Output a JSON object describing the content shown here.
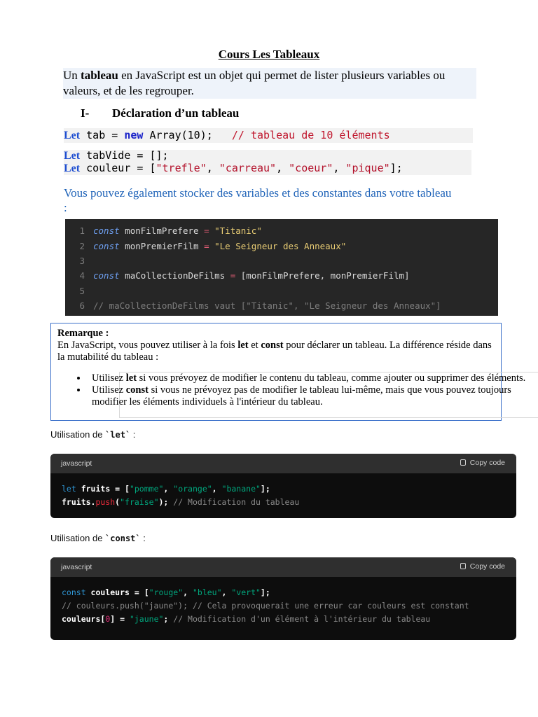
{
  "title": "Cours Les Tableaux",
  "intro": {
    "pre": "Un ",
    "bold": "tableau",
    "post": " en JavaScript est un objet qui permet de lister plusieurs variables ou valeurs, et de les regrouper."
  },
  "section1": {
    "number": "I-",
    "title": "Déclaration d’un tableau"
  },
  "code_examples": {
    "line1": {
      "kw": "Let",
      "a": "tab = ",
      "new": "new",
      "b": " Array(10);   ",
      "comment": "// tableau de 10 éléments"
    },
    "line2": {
      "kw": "Let",
      "a": "tabVide = [];"
    },
    "line3": {
      "kw": "Let",
      "a": "couleur = [",
      "s1": "\"trefle\"",
      "s2": "\"carreau\"",
      "s3": "\"coeur\"",
      "s4": "\"pique\"",
      "sep": ", ",
      "end": "];"
    }
  },
  "note_blue": "Vous pouvez également stocker des variables et des constantes dans votre tableau :",
  "dark_code": {
    "line_numbers": [
      "1",
      "2",
      "3",
      "4",
      "5",
      "6"
    ],
    "l1": {
      "kw": "const",
      "id": " monFilmPrefere ",
      "op": "=",
      "str": " \"Titanic\""
    },
    "l2": {
      "kw": "const",
      "id": " monPremierFilm ",
      "op": "=",
      "str": " \"Le Seigneur des Anneaux\""
    },
    "l4": {
      "kw": "const",
      "id": " maCollectionDeFilms ",
      "op": "=",
      "rest": " [monFilmPrefere, monPremierFilm]"
    },
    "l6": "// maCollectionDeFilms vaut [\"Titanic\", \"Le Seigneur des Anneaux\"]"
  },
  "remark": {
    "title": "Remarque :",
    "body_1": "En JavaScript, vous pouvez utiliser à la fois ",
    "let": "let",
    "body_2": " et ",
    "const": "const",
    "body_3": " pour déclarer un tableau. La différence réside dans la mutabilité du tableau :",
    "items": [
      {
        "pre": "Utilisez ",
        "kw": "let",
        "post": " si vous prévoyez de modifier le contenu du tableau, comme ajouter ou supprimer des éléments."
      },
      {
        "pre": "Utilisez ",
        "kw": "const",
        "post": " si vous ne prévoyez pas de modifier le tableau lui-même, mais que vous pouvez toujours modifier les éléments individuels à l'intérieur du tableau."
      }
    ]
  },
  "usage_let": {
    "label": "Utilisation de ",
    "code": "`let`",
    "suffix": " :"
  },
  "usage_const": {
    "label": "Utilisation de ",
    "code": "`const`",
    "suffix": " :"
  },
  "block_let": {
    "lang": "javascript",
    "copy": "Copy code",
    "l1": {
      "kw": "let",
      "id": " fruits = [",
      "s1": "\"pomme\"",
      "s2": "\"orange\"",
      "s3": "\"banane\"",
      "sep": ", ",
      "end": "];"
    },
    "l2": {
      "id": "fruits.",
      "fn": "push",
      "p1": "(",
      "s": "\"fraise\"",
      "p2": "); ",
      "cm": "// Modification du tableau"
    }
  },
  "block_const": {
    "lang": "javascript",
    "copy": "Copy code",
    "l1": {
      "kw": "const",
      "id": " couleurs = [",
      "s1": "\"rouge\"",
      "s2": "\"bleu\"",
      "s3": "\"vert\"",
      "sep": ", ",
      "end": "];"
    },
    "l2": "// couleurs.push(\"jaune\"); // Cela provoquerait une erreur car couleurs est constant",
    "l3": {
      "id": "couleurs[",
      "num": "0",
      "id2": "] = ",
      "s": "\"jaune\"",
      "p": "; ",
      "cm": "// Modification d'un élément à l'intérieur du tableau"
    }
  }
}
